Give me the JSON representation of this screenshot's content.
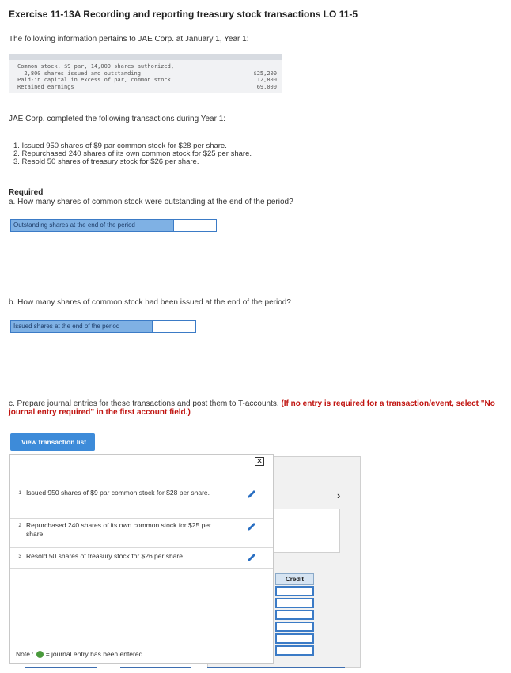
{
  "header": {
    "title": "Exercise 11-13A Recording and reporting treasury stock transactions LO 11-5",
    "intro": "The following information pertains to JAE Corp. at January 1, Year 1:"
  },
  "info_table": {
    "rows": [
      {
        "label": "Common stock, $9 par, 14,000 shares authorized,",
        "value": ""
      },
      {
        "label": "  2,800 shares issued and outstanding",
        "value": "$25,200"
      },
      {
        "label": "Paid-in capital in excess of par, common stock",
        "value": "12,800"
      },
      {
        "label": "Retained earnings",
        "value": "69,000"
      }
    ]
  },
  "completed_text": "JAE Corp. completed the following transactions during Year 1:",
  "transactions": [
    "1. Issued 950 shares of $9 par common stock for $28 per share.",
    "2. Repurchased 240 shares of its own common stock for $25 per share.",
    "3. Resold 50 shares of treasury stock for $26 per share."
  ],
  "required": {
    "heading": "Required",
    "question_a": "a. How many shares of common stock were outstanding at the end of the period?",
    "answer_a_label": "Outstanding shares at the end of the period",
    "answer_a_value": "",
    "question_b": "b. How many shares of common stock had been issued at the end of the period?",
    "answer_b_label": "Issued shares at the end of the period",
    "answer_b_value": "",
    "question_c": "c. Prepare journal entries for these transactions and post them to T-accounts.",
    "question_c_note": "(If no entry is required for a transaction/event, select \"No journal entry required\" in the first account field.)"
  },
  "view_button": "View transaction list",
  "modal": {
    "close_icon": "close-icon",
    "items": [
      {
        "num": "1",
        "text": "Issued 950 shares of $9 par common stock for $28 per share."
      },
      {
        "num": "2",
        "text": "Repurchased 240 shares of its own common stock for $25 per share."
      },
      {
        "num": "3",
        "text": "Resold 50 shares of treasury stock for $26 per share."
      }
    ],
    "note_prefix": "Note :",
    "note_suffix": "= journal entry has been entered"
  },
  "background": {
    "credit_label": "Credit",
    "chevron": "›"
  },
  "colors": {
    "accent": "#3d8bd9",
    "answer_label_bg": "#7fb1e4",
    "warning_red": "#c0130f",
    "entered_dot": "#4a9a3c"
  }
}
